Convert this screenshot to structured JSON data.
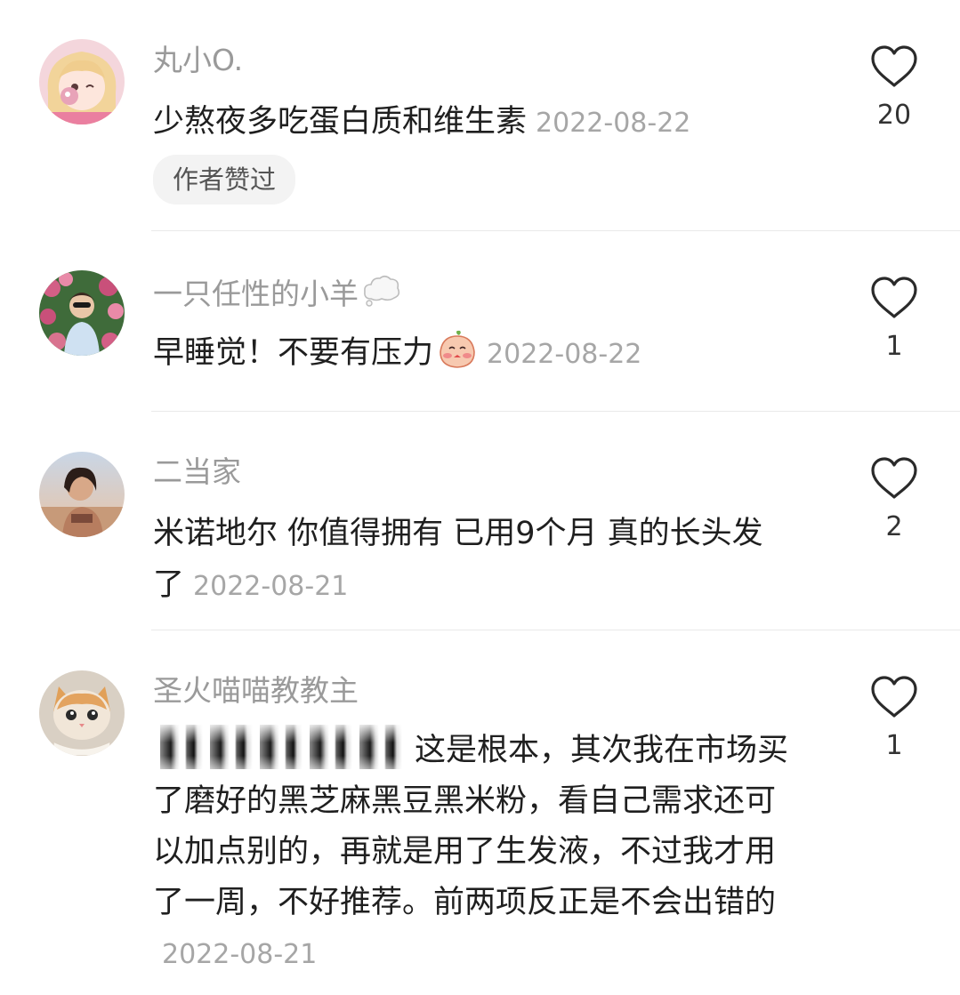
{
  "comments": [
    {
      "username": "丸小O.",
      "text": "少熬夜多吃蛋白质和维生素",
      "date": "2022-08-22",
      "badge": "作者赞过",
      "likes": "20"
    },
    {
      "username": "一只任性的小羊",
      "username_icon": "thought-bubble-icon",
      "text": "早睡觉！不要有压力",
      "text_emoji": "peach-face-emoji",
      "date": "2022-08-22",
      "likes": "1"
    },
    {
      "username": "二当家",
      "text": "米诺地尔 你值得拥有 已用9个月 真的长头发了",
      "date": "2022-08-21",
      "likes": "2"
    },
    {
      "username": "圣火喵喵教教主",
      "text": "这是根本，其次我在市场买了磨好的黑芝麻黑豆黑米粉，看自己需求还可以加点别的，再就是用了生发液，不过我才用了一周，不好推荐。前两项反正是不会出错的",
      "date": "2022-08-21",
      "likes": "1"
    }
  ],
  "icons": {
    "like": "heart-outline-icon"
  },
  "colors": {
    "username": "#9a9a9a",
    "text": "#1f1f1f",
    "date": "#a6a6a6",
    "badge_bg": "#f3f3f3",
    "divider": "#e9e9e9"
  }
}
